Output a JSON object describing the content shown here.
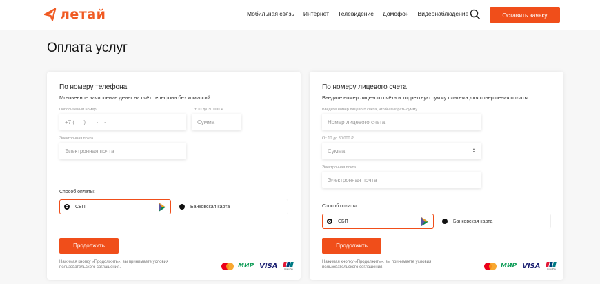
{
  "header": {
    "logo_text": "летай",
    "nav": [
      "Мобильная связь",
      "Интернет",
      "Телевидение",
      "Домофон",
      "Видеонаблюдение"
    ],
    "cta_label": "Оставить заявку"
  },
  "page": {
    "title": "Оплата услуг"
  },
  "phone_card": {
    "title": "По номеру телефона",
    "subtitle": "Мгновенное зачисление денег на счёт телефона без комиссий",
    "phone_label": "Пополняемый номер",
    "phone_placeholder": "+7 (___) ___-__-__",
    "amount_label": "От 10 до 30 000 ₽",
    "amount_placeholder": "Сумма",
    "email_label": "Электронная почта",
    "email_placeholder": "Электронная почта",
    "payment_label": "Способ оплаты:",
    "option_sbp": "СБП",
    "option_card": "Банковская карта",
    "continue_label": "Продолжить",
    "terms": "Нажимая кнопку «Продолжить», вы принимаете условия пользовательского соглашения."
  },
  "account_card": {
    "title": "По номеру лицевого счета",
    "subtitle": "Введите номер лицевого счёта и корректную сумму платежа для совершения оплаты.",
    "account_label": "Введите номер лицевого счёта, чтобы выбрать сумму",
    "account_placeholder": "Номер лицевого счета",
    "amount_label": "От 10 до 30 000 ₽",
    "amount_placeholder": "Сумма",
    "email_label": "Электронная почта",
    "email_placeholder": "Электронная почта",
    "payment_label": "Способ оплаты:",
    "option_sbp": "СБП",
    "option_card": "Банковская карта",
    "continue_label": "Продолжить",
    "terms": "Нажимая кнопку «Продолжить», вы принимаете условия пользовательского соглашения."
  },
  "payment_logos": {
    "mir": "МИР",
    "visa": "VISA",
    "unionpay": "UnionPay"
  },
  "colors": {
    "brand": "#f04e1a",
    "logo": "#f05a22",
    "mir": "#0f9d58",
    "visa": "#1a1f71"
  }
}
